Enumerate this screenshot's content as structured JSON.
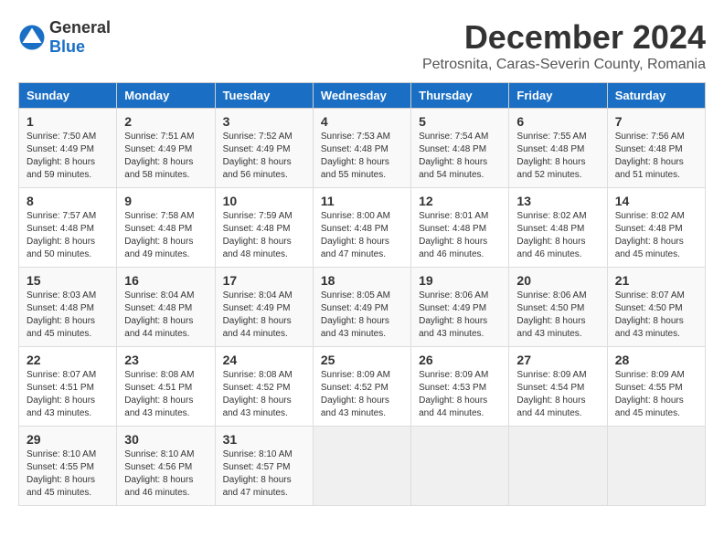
{
  "header": {
    "logo_general": "General",
    "logo_blue": "Blue",
    "month_title": "December 2024",
    "location": "Petrosnita, Caras-Severin County, Romania"
  },
  "days_of_week": [
    "Sunday",
    "Monday",
    "Tuesday",
    "Wednesday",
    "Thursday",
    "Friday",
    "Saturday"
  ],
  "weeks": [
    [
      {
        "day": "1",
        "sunrise": "7:50 AM",
        "sunset": "4:49 PM",
        "daylight": "8 hours and 59 minutes."
      },
      {
        "day": "2",
        "sunrise": "7:51 AM",
        "sunset": "4:49 PM",
        "daylight": "8 hours and 58 minutes."
      },
      {
        "day": "3",
        "sunrise": "7:52 AM",
        "sunset": "4:49 PM",
        "daylight": "8 hours and 56 minutes."
      },
      {
        "day": "4",
        "sunrise": "7:53 AM",
        "sunset": "4:48 PM",
        "daylight": "8 hours and 55 minutes."
      },
      {
        "day": "5",
        "sunrise": "7:54 AM",
        "sunset": "4:48 PM",
        "daylight": "8 hours and 54 minutes."
      },
      {
        "day": "6",
        "sunrise": "7:55 AM",
        "sunset": "4:48 PM",
        "daylight": "8 hours and 52 minutes."
      },
      {
        "day": "7",
        "sunrise": "7:56 AM",
        "sunset": "4:48 PM",
        "daylight": "8 hours and 51 minutes."
      }
    ],
    [
      {
        "day": "8",
        "sunrise": "7:57 AM",
        "sunset": "4:48 PM",
        "daylight": "8 hours and 50 minutes."
      },
      {
        "day": "9",
        "sunrise": "7:58 AM",
        "sunset": "4:48 PM",
        "daylight": "8 hours and 49 minutes."
      },
      {
        "day": "10",
        "sunrise": "7:59 AM",
        "sunset": "4:48 PM",
        "daylight": "8 hours and 48 minutes."
      },
      {
        "day": "11",
        "sunrise": "8:00 AM",
        "sunset": "4:48 PM",
        "daylight": "8 hours and 47 minutes."
      },
      {
        "day": "12",
        "sunrise": "8:01 AM",
        "sunset": "4:48 PM",
        "daylight": "8 hours and 46 minutes."
      },
      {
        "day": "13",
        "sunrise": "8:02 AM",
        "sunset": "4:48 PM",
        "daylight": "8 hours and 46 minutes."
      },
      {
        "day": "14",
        "sunrise": "8:02 AM",
        "sunset": "4:48 PM",
        "daylight": "8 hours and 45 minutes."
      }
    ],
    [
      {
        "day": "15",
        "sunrise": "8:03 AM",
        "sunset": "4:48 PM",
        "daylight": "8 hours and 45 minutes."
      },
      {
        "day": "16",
        "sunrise": "8:04 AM",
        "sunset": "4:48 PM",
        "daylight": "8 hours and 44 minutes."
      },
      {
        "day": "17",
        "sunrise": "8:04 AM",
        "sunset": "4:49 PM",
        "daylight": "8 hours and 44 minutes."
      },
      {
        "day": "18",
        "sunrise": "8:05 AM",
        "sunset": "4:49 PM",
        "daylight": "8 hours and 43 minutes."
      },
      {
        "day": "19",
        "sunrise": "8:06 AM",
        "sunset": "4:49 PM",
        "daylight": "8 hours and 43 minutes."
      },
      {
        "day": "20",
        "sunrise": "8:06 AM",
        "sunset": "4:50 PM",
        "daylight": "8 hours and 43 minutes."
      },
      {
        "day": "21",
        "sunrise": "8:07 AM",
        "sunset": "4:50 PM",
        "daylight": "8 hours and 43 minutes."
      }
    ],
    [
      {
        "day": "22",
        "sunrise": "8:07 AM",
        "sunset": "4:51 PM",
        "daylight": "8 hours and 43 minutes."
      },
      {
        "day": "23",
        "sunrise": "8:08 AM",
        "sunset": "4:51 PM",
        "daylight": "8 hours and 43 minutes."
      },
      {
        "day": "24",
        "sunrise": "8:08 AM",
        "sunset": "4:52 PM",
        "daylight": "8 hours and 43 minutes."
      },
      {
        "day": "25",
        "sunrise": "8:09 AM",
        "sunset": "4:52 PM",
        "daylight": "8 hours and 43 minutes."
      },
      {
        "day": "26",
        "sunrise": "8:09 AM",
        "sunset": "4:53 PM",
        "daylight": "8 hours and 44 minutes."
      },
      {
        "day": "27",
        "sunrise": "8:09 AM",
        "sunset": "4:54 PM",
        "daylight": "8 hours and 44 minutes."
      },
      {
        "day": "28",
        "sunrise": "8:09 AM",
        "sunset": "4:55 PM",
        "daylight": "8 hours and 45 minutes."
      }
    ],
    [
      {
        "day": "29",
        "sunrise": "8:10 AM",
        "sunset": "4:55 PM",
        "daylight": "8 hours and 45 minutes."
      },
      {
        "day": "30",
        "sunrise": "8:10 AM",
        "sunset": "4:56 PM",
        "daylight": "8 hours and 46 minutes."
      },
      {
        "day": "31",
        "sunrise": "8:10 AM",
        "sunset": "4:57 PM",
        "daylight": "8 hours and 47 minutes."
      },
      null,
      null,
      null,
      null
    ]
  ],
  "labels": {
    "sunrise": "Sunrise:",
    "sunset": "Sunset:",
    "daylight": "Daylight:"
  }
}
